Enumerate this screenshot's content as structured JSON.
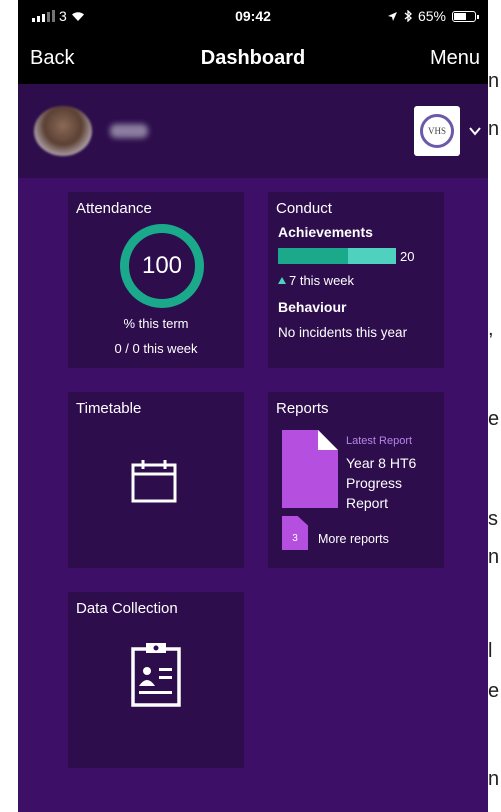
{
  "background_page": {
    "fragments": [
      "n",
      "n",
      ",",
      "e",
      "s",
      "n",
      "l",
      "e",
      "n"
    ]
  },
  "status_bar": {
    "carrier": "3",
    "time": "09:42",
    "battery": "65%",
    "battery_level": 0.65
  },
  "nav": {
    "back_label": "Back",
    "title": "Dashboard",
    "menu_label": "Menu"
  },
  "profile": {
    "school_logo_text": "VHS"
  },
  "tiles": {
    "attendance": {
      "title": "Attendance",
      "value": "100",
      "term_label": "% this term",
      "week_label": "0 / 0 this week",
      "ring_color": "#1aa98a"
    },
    "conduct": {
      "title": "Conduct",
      "achievements_label": "Achievements",
      "achievements_count": "20",
      "achievements_week": "7 this week",
      "behaviour_label": "Behaviour",
      "behaviour_text": "No incidents this year"
    },
    "timetable": {
      "title": "Timetable",
      "icon": "calendar-icon"
    },
    "reports": {
      "title": "Reports",
      "latest_label": "Latest Report",
      "latest_name": "Year 8 HT6 Progress Report",
      "more_count": "3",
      "more_label": "More reports"
    },
    "data_collection": {
      "title": "Data Collection",
      "icon": "clipboard-icon"
    }
  },
  "colors": {
    "background": "#3e0f66",
    "tile": "#2d0d4c",
    "accent_teal": "#1aa98a",
    "accent_purple": "#b44fe0",
    "latest_label": "#b884e8"
  }
}
